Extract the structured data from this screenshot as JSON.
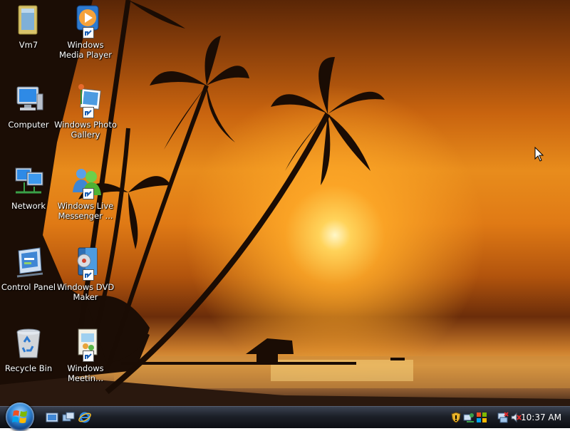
{
  "desktop_icons": [
    {
      "label": "Vm7",
      "icon": "folder-icon"
    },
    {
      "label": "Windows Media Player",
      "icon": "media-player-icon"
    },
    {
      "label": "Computer",
      "icon": "computer-icon"
    },
    {
      "label": "Windows Photo Gallery",
      "icon": "photo-gallery-icon"
    },
    {
      "label": "Network",
      "icon": "network-icon"
    },
    {
      "label": "Windows Live Messenger ...",
      "icon": "messenger-icon"
    },
    {
      "label": "Control Panel",
      "icon": "control-panel-icon"
    },
    {
      "label": "Windows DVD Maker",
      "icon": "dvd-maker-icon"
    },
    {
      "label": "Recycle Bin",
      "icon": "recycle-bin-icon"
    },
    {
      "label": "Windows Meetin...",
      "icon": "meeting-space-icon"
    }
  ],
  "taskbar": {
    "start_button": "start-orb-icon",
    "quick_launch": [
      "show-desktop-icon",
      "switch-windows-icon",
      "internet-explorer-icon"
    ],
    "tray_icons": [
      "security-shield-icon",
      "network-status-icon",
      "windows-update-icon",
      "network-disconnected-icon",
      "volume-muted-icon"
    ],
    "clock": "10:37 AM"
  },
  "colors": {
    "sky_orange": "#e88c1c",
    "sun": "#ffd35a",
    "taskbar": "#1c2028",
    "vista_blue": "#2f86d6"
  }
}
